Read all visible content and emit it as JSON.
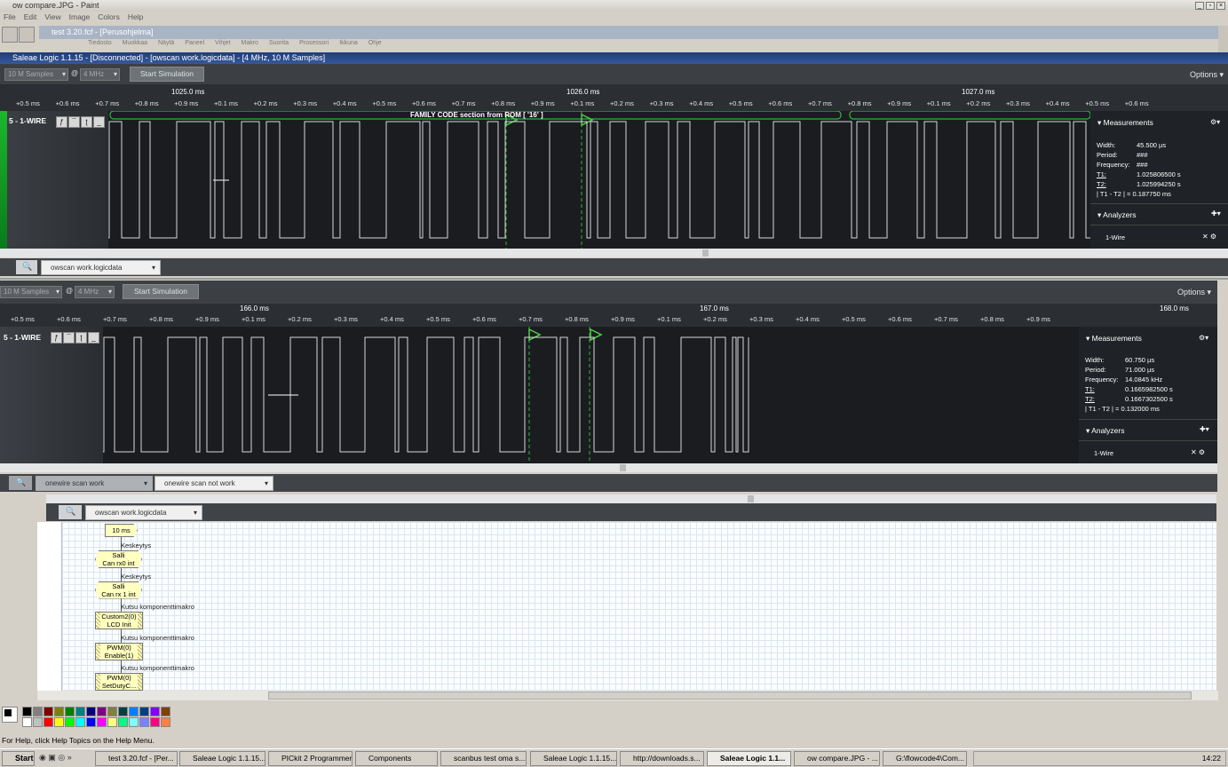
{
  "paint": {
    "title": "ow compare.JPG - Paint",
    "menu": [
      "File",
      "Edit",
      "View",
      "Image",
      "Colors",
      "Help"
    ],
    "status": "For Help, click Help Topics on the Help Menu."
  },
  "flowcode": {
    "title": "test 3.20.fcf - [Perusohjelma]",
    "menu": [
      "Tiedosto",
      "Muokkaa",
      "Näytä",
      "Paneel",
      "Vihjet",
      "Makro",
      "Suorita",
      "Prosessori",
      "Ikkuna",
      "Ohje"
    ]
  },
  "saleae_top": {
    "title": "Saleae Logic 1.1.15 - [Disconnected] - [owscan work.logicdata] - [4 MHz, 10 M Samples]",
    "samples": "10 M Samples",
    "at": "@",
    "rate": "4 MHz",
    "start_btn": "Start Simulation",
    "options": "Options",
    "majors": [
      "1025.0 ms",
      "1026.0 ms",
      "1027.0 ms"
    ],
    "ticks": [
      "+0.6 ms",
      "+0.7 ms",
      "+0.8 ms",
      "+0.9 ms",
      "+0.1 ms",
      "+0.2 ms",
      "+0.3 ms",
      "+0.4 ms",
      "+0.5 ms",
      "+0.6 ms",
      "+0.7 ms",
      "+0.8 ms",
      "+0.9 ms",
      "+0.1 ms",
      "+0.2 ms",
      "+0.3 ms",
      "+0.4 ms",
      "+0.5 ms",
      "+0.6 ms",
      "+0.7 ms",
      "+0.8 ms",
      "+0.9 ms",
      "+0.1 ms",
      "+0.2 ms",
      "+0.3 ms",
      "+0.4 ms",
      "+0.5 ms",
      "+0.6 ms"
    ],
    "first_tick": "+0.5 ms",
    "channel": "5 - 1-WIRE",
    "annotation": "FAMILY CODE section from ROM [ '16' ]",
    "measurements": {
      "header": "Measurements",
      "width_label": "Width:",
      "width": "45.500 µs",
      "period_label": "Period:",
      "period": "###",
      "freq_label": "Frequency:",
      "freq": "###",
      "t1_label": "T1:",
      "t1": "1.025806500 s",
      "t2_label": "T2:",
      "t2": "1.025994250 s",
      "diff_label": "| T1 - T2 | =",
      "diff": "0.187750 ms"
    },
    "analyzers": "Analyzers",
    "analyzer_item": "1-Wire",
    "tab": "owscan work.logicdata"
  },
  "saleae_bottom": {
    "samples": "10 M Samples",
    "at": "@",
    "rate": "4 MHz",
    "start_btn": "Start Simulation",
    "options": "Options",
    "majors": [
      "166.0 ms",
      "167.0 ms",
      "168.0 ms"
    ],
    "ticks": [
      "+0.5 ms",
      "+0.6 ms",
      "+0.7 ms",
      "+0.8 ms",
      "+0.9 ms",
      "+0.1 ms",
      "+0.2 ms",
      "+0.3 ms",
      "+0.4 ms",
      "+0.5 ms",
      "+0.6 ms",
      "+0.7 ms",
      "+0.8 ms",
      "+0.9 ms",
      "+0.1 ms",
      "+0.2 ms",
      "+0.3 ms",
      "+0.4 ms",
      "+0.5 ms",
      "+0.6 ms",
      "+0.7 ms",
      "+0.8 ms",
      "+0.9 ms"
    ],
    "channel": "5 - 1-WIRE",
    "measurements": {
      "header": "Measurements",
      "width_label": "Width:",
      "width": "60.750 µs",
      "period_label": "Period:",
      "period": "71.000 µs",
      "freq_label": "Frequency:",
      "freq": "14.0845 kHz",
      "t1_label": "T1:",
      "t1": "0.1665982500 s",
      "t2_label": "T2:",
      "t2": "0.1667302500 s",
      "diff_label": "| T1 - T2 | =",
      "diff": "0.132000 ms"
    },
    "analyzers": "Analyzers",
    "analyzer_item": "1-Wire",
    "tabs": [
      "onewire scan work",
      "onewire scan not work"
    ]
  },
  "saleae_third": {
    "tab": "owscan work.logicdata"
  },
  "flowchart": {
    "delay": "10 ms",
    "items": [
      {
        "note": "Keskeytys",
        "l1": "Salli",
        "l2": "Can rx0 int"
      },
      {
        "note": "Keskeytys",
        "l1": "Salli",
        "l2": "Can rx 1 int"
      },
      {
        "note": "Kutsu komponenttimakro",
        "l1": "Custom2(0)",
        "l2": "LCD Init"
      },
      {
        "note": "Kutsu komponenttimakro",
        "l1": "PWM(0)",
        "l2": "Enable(1)"
      },
      {
        "note": "Kutsu komponenttimakro",
        "l1": "PWM(0)",
        "l2": "SetDutyC..."
      }
    ]
  },
  "palette": [
    "#000000",
    "#808080",
    "#800000",
    "#808000",
    "#008000",
    "#008080",
    "#000080",
    "#800080",
    "#808040",
    "#004040",
    "#0080ff",
    "#004080",
    "#8000ff",
    "#804000",
    "#ffffff",
    "#c0c0c0",
    "#ff0000",
    "#ffff00",
    "#00ff00",
    "#00ffff",
    "#0000ff",
    "#ff00ff",
    "#ffff80",
    "#00ff80",
    "#80ffff",
    "#8080ff",
    "#ff0080",
    "#ff8040"
  ],
  "taskbar": {
    "start": "Start",
    "items": [
      "test 3.20.fcf - [Per...",
      "Saleae Logic 1.1.15...",
      "PICkit 2 Programmer",
      "Components",
      "scanbus test oma s...",
      "Saleae Logic 1.1.15...",
      "http://downloads.s...",
      "Saleae Logic 1.1...",
      "ow compare.JPG - ...",
      "G:\\flowcode4\\Com..."
    ],
    "active_index": 7,
    "clock": "14:22"
  }
}
